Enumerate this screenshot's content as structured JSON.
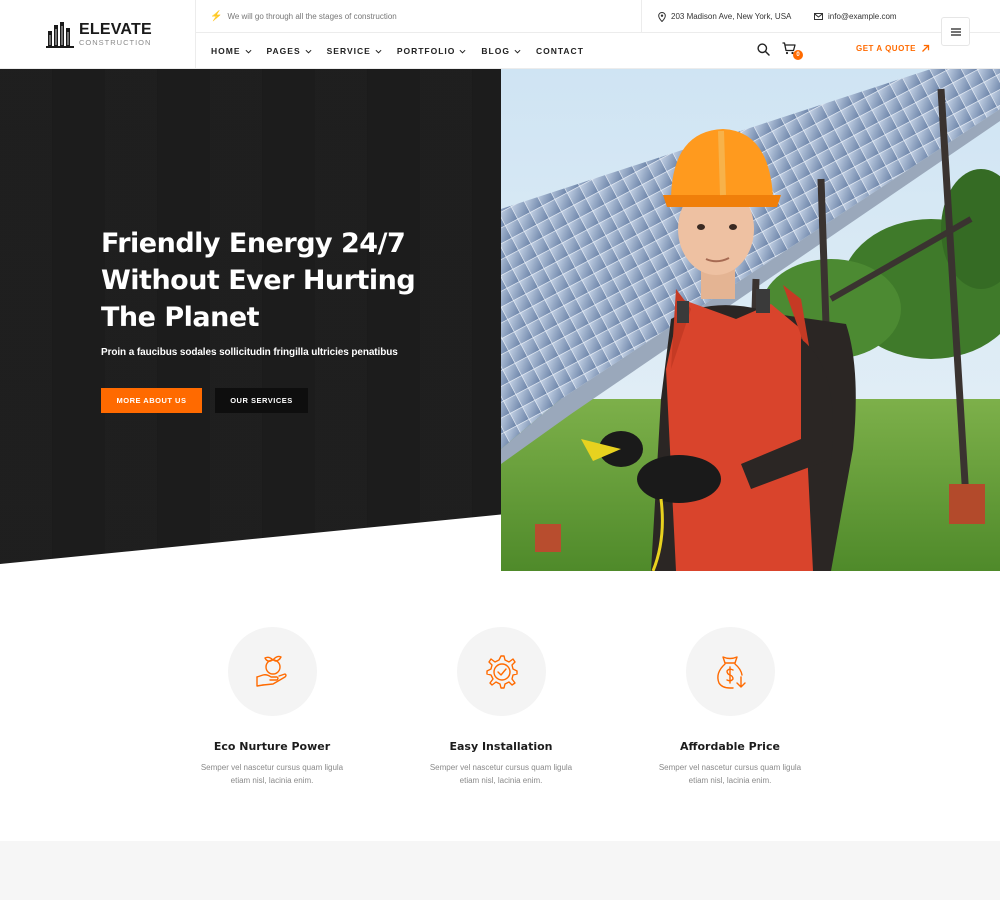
{
  "brand": {
    "name": "ELEVATE",
    "tagline": "CONSTRUCTION"
  },
  "topbar": {
    "notice": "We will go through all the stages of construction",
    "address": "203 Madison Ave, New York, USA",
    "email": "info@example.com"
  },
  "nav": {
    "items": [
      {
        "label": "HOME",
        "has_dropdown": true
      },
      {
        "label": "PAGES",
        "has_dropdown": true
      },
      {
        "label": "SERVICE",
        "has_dropdown": true
      },
      {
        "label": "PORTFOLIO",
        "has_dropdown": true
      },
      {
        "label": "BLOG",
        "has_dropdown": true
      },
      {
        "label": "CONTACT",
        "has_dropdown": false
      }
    ],
    "cart_count": "0",
    "quote_label": "GET A QUOTE"
  },
  "hero": {
    "title_line1": "Friendly Energy 24/7",
    "title_line2": "Without Ever Hurting",
    "title_line3": "The Planet",
    "subtitle": "Proin a faucibus sodales sollicitudin fringilla ultricies penatibus",
    "primary_button": "MORE ABOUT US",
    "secondary_button": "OUR SERVICES"
  },
  "features": [
    {
      "icon": "eco-hand-icon",
      "title": "Eco Nurture Power",
      "desc": "Semper vel nascetur cursus quam ligula etiam nisl, lacinia enim."
    },
    {
      "icon": "gear-check-icon",
      "title": "Easy Installation",
      "desc": "Semper vel nascetur cursus quam ligula etiam nisl, lacinia enim."
    },
    {
      "icon": "money-bag-icon",
      "title": "Affordable Price",
      "desc": "Semper vel nascetur cursus quam ligula etiam nisl, lacinia enim."
    }
  ],
  "colors": {
    "accent": "#ff6a00",
    "dark": "#1c1c1c",
    "muted": "#8a8a8a"
  }
}
